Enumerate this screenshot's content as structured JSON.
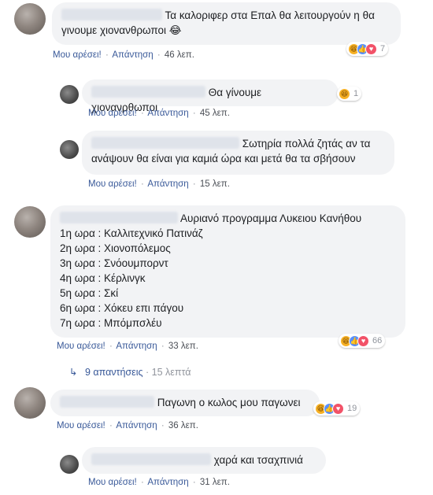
{
  "comments": [
    {
      "text": "Τα καλοριφερ στα Επαλ θα λειτουργούν η θα γινουμε χιονανθρωποι 😂",
      "like_label": "Μου αρέσει!",
      "reply_label": "Απάντηση",
      "time": "46 λεπ.",
      "reaction_count": "7"
    },
    {
      "text": "Θα γίνουμε χιονανρθωποι",
      "like_label": "Μου αρέσει!",
      "reply_label": "Απάντηση",
      "time": "45 λεπ.",
      "reaction_count": "1"
    },
    {
      "text_line1": "Σωτηρία πολλά ζητάς αν τα",
      "text_line2": "ανάψουν θα είναι για καμιά ώρα και μετά θα τα σβήσουν",
      "like_label": "Μου αρέσει!",
      "reply_label": "Απάντηση",
      "time": "15 λεπ."
    },
    {
      "title": "Αυριανό προγραμμα Λυκειου Κανήθου",
      "lines": [
        "1η ωρα : Καλλιτεχνικό Πατινάζ",
        "2η ωρα : Χιονοπόλεμος",
        "3η ωρα : Σνόουμπορντ",
        "4η ωρα : Κέρλινγκ",
        "5η ωρα : Σκί",
        "6η ωρα : Χόκευ επι πάγου",
        "7η ωρα : Μπόμπσλέυ"
      ],
      "like_label": "Μου αρέσει!",
      "reply_label": "Απάντηση",
      "time": "33 λεπ.",
      "reaction_count": "66",
      "replies_label": "9 απαντήσεις",
      "replies_time": "15 λεπτά"
    },
    {
      "text": "Παγωνη ο κωλος μου παγωνει",
      "like_label": "Μου αρέσει!",
      "reply_label": "Απάντηση",
      "time": "36 λεπ.",
      "reaction_count": "19"
    },
    {
      "text": "χαρά και τσαχπινιά",
      "like_label": "Μου αρέσει!",
      "reply_label": "Απάντηση",
      "time": "31 λεπ."
    }
  ],
  "separator": "·",
  "icons": {
    "haha": "haha-reaction-icon",
    "like": "like-reaction-icon",
    "love": "love-reaction-icon",
    "reply_arrow": "reply-arrow-icon"
  },
  "colors": {
    "link": "#385898",
    "bubble": "#f2f3f5",
    "like": "#5890ff",
    "love": "#f25268",
    "haha": "#f7b125"
  }
}
